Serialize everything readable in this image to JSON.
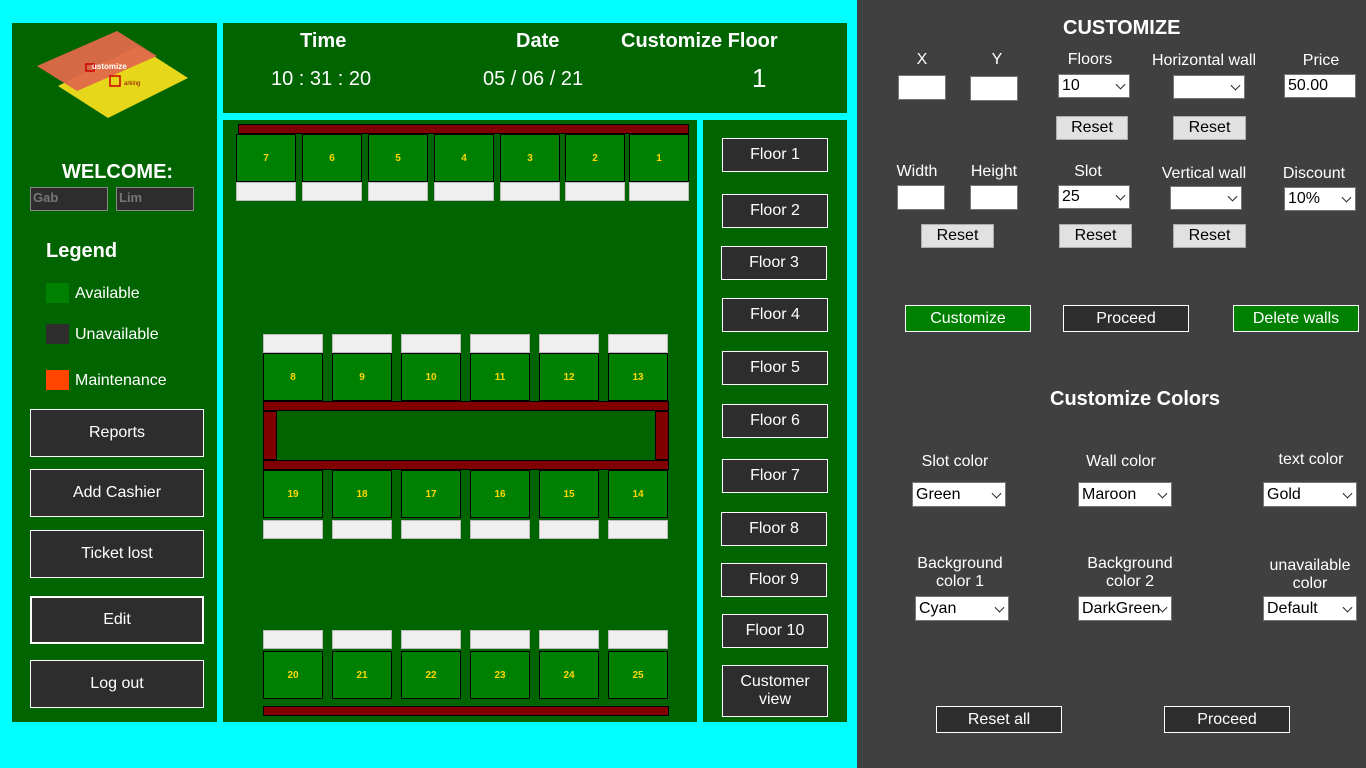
{
  "logo": {
    "line1": "ustomize",
    "line2": "arking"
  },
  "header": {
    "time_label": "Time",
    "time_value": "10 : 31 : 20",
    "date_label": "Date",
    "date_value": "05 / 06 / 21",
    "floor_label": "Customize Floor",
    "floor_value": "1"
  },
  "sidebar": {
    "welcome": "WELCOME:",
    "first_name": "Gab",
    "last_name": "Lim",
    "legend_title": "Legend",
    "legend": [
      {
        "label": "Available",
        "color": "#008000"
      },
      {
        "label": "Unavailable",
        "color": "#2d2d2d"
      },
      {
        "label": "Maintenance",
        "color": "#ff4500"
      }
    ],
    "buttons": [
      "Reports",
      "Add Cashier",
      "Ticket lost",
      "Edit",
      "Log out"
    ]
  },
  "slots": {
    "row1": [
      "7",
      "6",
      "5",
      "4",
      "3",
      "2",
      "1"
    ],
    "row2": [
      "8",
      "9",
      "10",
      "11",
      "12",
      "13"
    ],
    "row3": [
      "19",
      "18",
      "17",
      "16",
      "15",
      "14"
    ],
    "row4": [
      "20",
      "21",
      "22",
      "23",
      "24",
      "25"
    ]
  },
  "floors": [
    "Floor 1",
    "Floor 2",
    "Floor 3",
    "Floor 4",
    "Floor 5",
    "Floor 6",
    "Floor 7",
    "Floor 8",
    "Floor 9",
    "Floor 10"
  ],
  "customer_view": {
    "line1": "Customer",
    "line2": "view"
  },
  "customize": {
    "title": "CUSTOMIZE",
    "x_label": "X",
    "y_label": "Y",
    "floors_label": "Floors",
    "floors_value": "10",
    "hwall_label": "Horizontal wall",
    "hwall_value": "",
    "price_label": "Price",
    "price_value": "50.00",
    "width_label": "Width",
    "height_label": "Height",
    "slot_label": "Slot",
    "slot_value": "25",
    "vwall_label": "Vertical wall",
    "vwall_value": "",
    "discount_label": "Discount",
    "discount_value": "10%",
    "reset": "Reset",
    "customize_btn": "Customize",
    "proceed_btn": "Proceed",
    "delete_walls_btn": "Delete walls"
  },
  "colors": {
    "title": "Customize Colors",
    "slot_label": "Slot color",
    "slot_value": "Green",
    "wall_label": "Wall color",
    "wall_value": "Maroon",
    "text_label": "text color",
    "text_value": "Gold",
    "bg1_label_1": "Background",
    "bg1_label_2": "color 1",
    "bg1_value": "Cyan",
    "bg2_label_1": "Background",
    "bg2_label_2": "color 2",
    "bg2_value": "DarkGreen",
    "unav_label_1": "unavailable",
    "unav_label_2": "color",
    "unav_value": "Default"
  },
  "footer": {
    "reset_all": "Reset all",
    "proceed": "Proceed"
  }
}
